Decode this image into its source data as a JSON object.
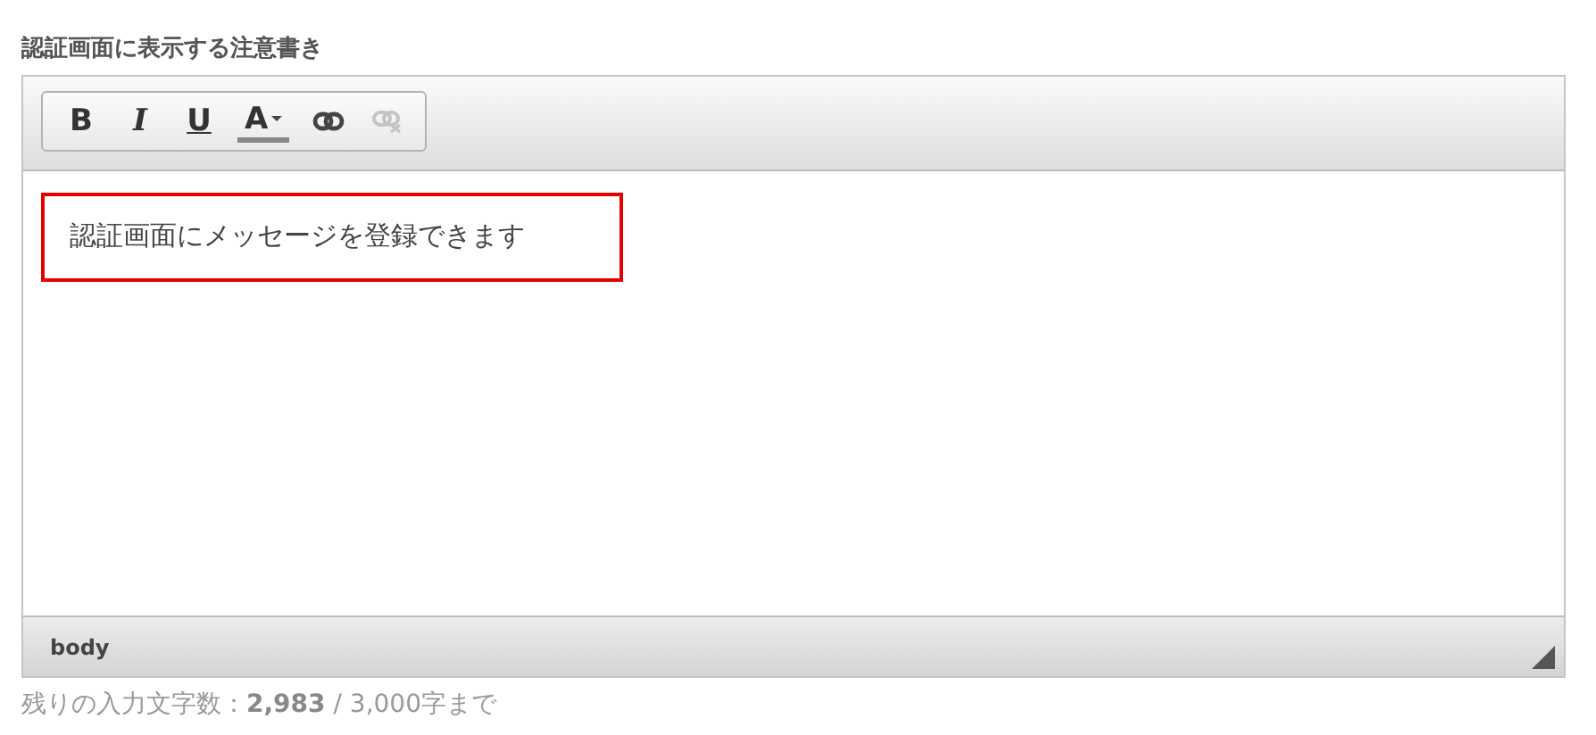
{
  "field_label": "認証画面に表示する注意書き",
  "toolbar": [
    {
      "kind": "bold",
      "label": "B",
      "disabled": false
    },
    {
      "kind": "italic",
      "label": "I",
      "disabled": false
    },
    {
      "kind": "underline",
      "label": "U",
      "disabled": false
    },
    {
      "kind": "color",
      "label": "A",
      "disabled": false
    },
    {
      "kind": "link",
      "disabled": false
    },
    {
      "kind": "unlink",
      "disabled": true
    }
  ],
  "content": {
    "text": "認証画面にメッセージを登録できます",
    "highlighted": true
  },
  "status_bar": {
    "path": "body"
  },
  "counter": {
    "text": "残りの入力文字数：**2,983** / 3,000字まで"
  }
}
